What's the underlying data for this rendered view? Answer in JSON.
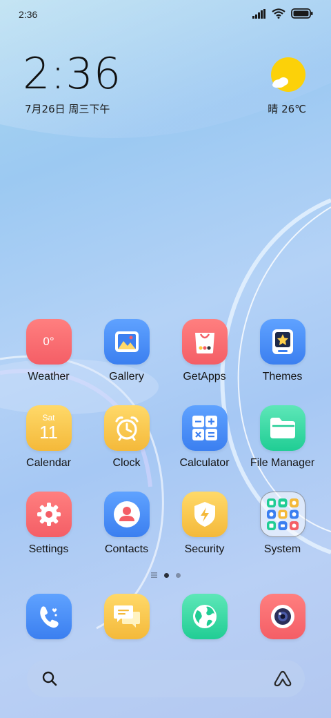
{
  "status_bar": {
    "time": "2:36",
    "battery_icon": "battery-icon",
    "wifi_icon": "wifi-icon",
    "signal_icon": "signal-icon"
  },
  "clock_widget": {
    "time": "2:36",
    "date": "7月26日 周三下午"
  },
  "weather_widget": {
    "icon": "sun-cloud-icon",
    "text": "晴 26℃"
  },
  "apps": [
    {
      "label": "Weather",
      "icon": "weather-icon",
      "icon_text": "0°",
      "color": "#f45e66"
    },
    {
      "label": "Gallery",
      "icon": "gallery-icon",
      "color": "#3b7ff0"
    },
    {
      "label": "GetApps",
      "icon": "getapps-icon",
      "color": "#f45e66"
    },
    {
      "label": "Themes",
      "icon": "themes-icon",
      "color": "#3b7ff0"
    },
    {
      "label": "Calendar",
      "icon": "calendar-icon",
      "icon_day": "Sat",
      "icon_date": "11",
      "color": "#f4b93a"
    },
    {
      "label": "Clock",
      "icon": "alarm-clock-icon",
      "color": "#f4b93a"
    },
    {
      "label": "Calculator",
      "icon": "calculator-icon",
      "color": "#3b7ff0"
    },
    {
      "label": "File Manager",
      "icon": "folder-icon",
      "color": "#20cd94"
    },
    {
      "label": "Settings",
      "icon": "gear-icon",
      "color": "#f45e66"
    },
    {
      "label": "Contacts",
      "icon": "contact-icon",
      "color": "#3b7ff0"
    },
    {
      "label": "Security",
      "icon": "shield-icon",
      "color": "#f4b93a"
    },
    {
      "label": "System",
      "icon": "folder-grid-icon",
      "color": "#ffffff"
    }
  ],
  "page_indicator": {
    "pages": 2,
    "current": 1
  },
  "dock": [
    {
      "name": "Phone",
      "icon": "phone-icon",
      "color": "#3b7ff0"
    },
    {
      "name": "Messages",
      "icon": "messages-icon",
      "color": "#f4b93a"
    },
    {
      "name": "Browser",
      "icon": "globe-icon",
      "color": "#20cd94"
    },
    {
      "name": "Camera",
      "icon": "camera-icon",
      "color": "#f45e66"
    }
  ],
  "search_bar": {
    "search_icon": "search-icon",
    "assistant_icon": "assistant-icon"
  }
}
